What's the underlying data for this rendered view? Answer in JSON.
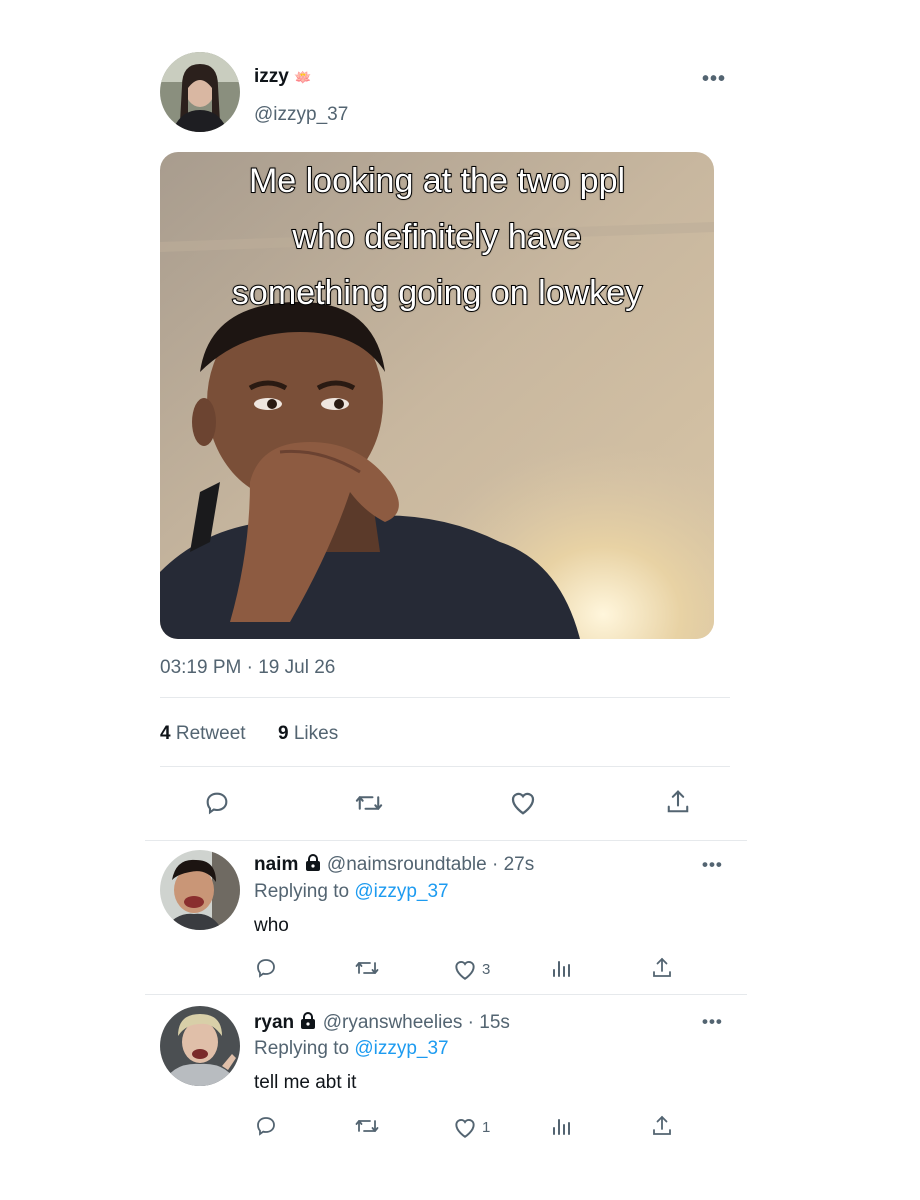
{
  "tweet": {
    "author": {
      "name": "izzy",
      "emoji": "🪷",
      "handle": "@izzyp_37"
    },
    "more_label": "•••",
    "image": {
      "caption_lines": [
        "Me looking at the two ppl",
        "who definitely have",
        "something going on lowkey"
      ]
    },
    "timestamp": "03:19 PM · 19 Jul 26",
    "stats": {
      "retweet_count": "4",
      "retweet_label": "Retweet",
      "likes_count": "9",
      "likes_label": "Likes"
    },
    "actions": [
      "reply-icon",
      "retweet-icon",
      "like-icon",
      "share-icon"
    ]
  },
  "replies": [
    {
      "name": "naim",
      "handle": "@naimsroundtable",
      "time": "· 27s",
      "replying_prefix": "Replying to",
      "replying_handle": "@izzyp_37",
      "text": "who",
      "like_count": "3",
      "more_label": "•••"
    },
    {
      "name": "ryan",
      "handle": "@ryanswheelies",
      "time": "· 15s",
      "replying_prefix": "Replying to",
      "replying_handle": "@izzyp_37",
      "text": "tell me abt it",
      "like_count": "1",
      "more_label": "•••"
    }
  ],
  "colors": {
    "text": "#0f1419",
    "muted": "#536471",
    "link": "#1d9bf0",
    "divider": "#e6e9ec"
  }
}
